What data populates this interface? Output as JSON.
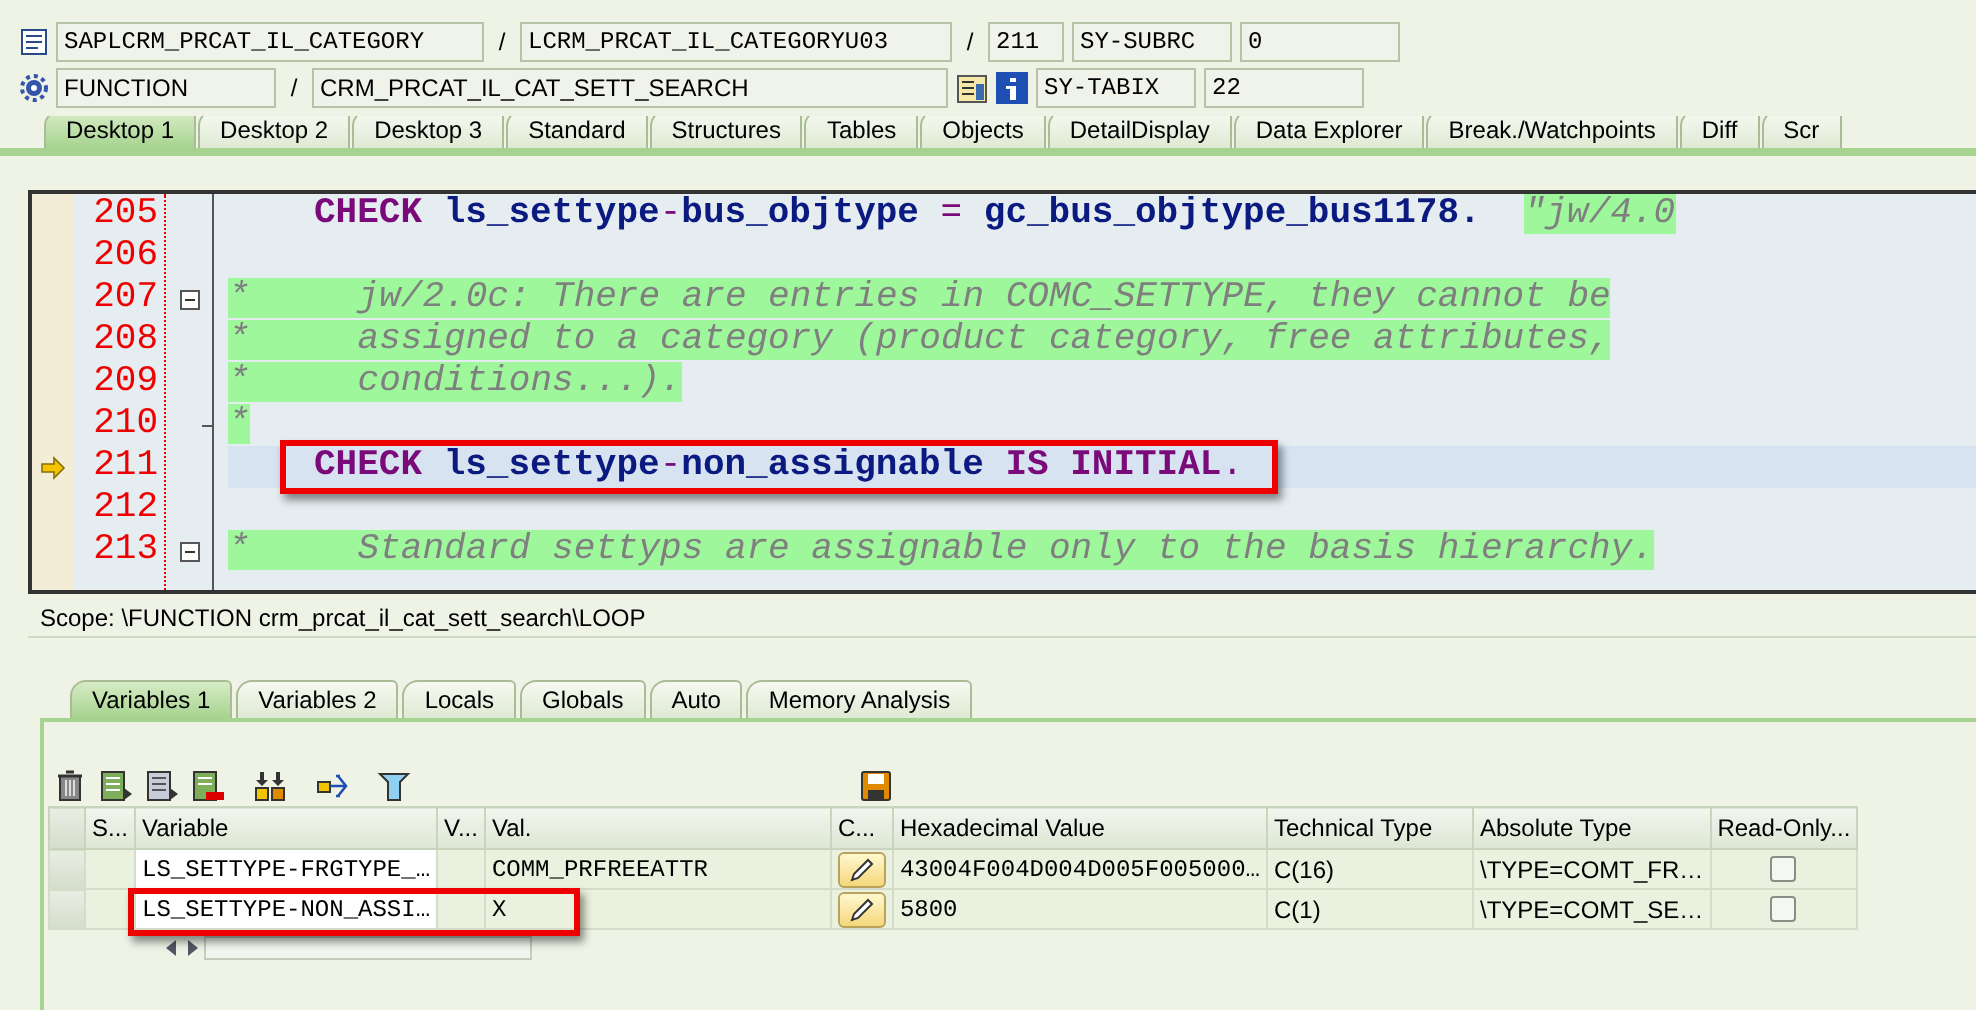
{
  "header": {
    "program": "SAPLCRM_PRCAT_IL_CATEGORY",
    "separator_1": "/",
    "include": "LCRM_PRCAT_IL_CATEGORYU03",
    "separator_2": "/",
    "line": "211",
    "field_1_name": "SY-SUBRC",
    "field_1_value": "0",
    "event_type": "FUNCTION",
    "separator_3": "/",
    "event_name": "CRM_PRCAT_IL_CAT_SETT_SEARCH",
    "field_2_name": "SY-TABIX",
    "field_2_value": "22"
  },
  "desktop_tabs": [
    {
      "label": "Desktop 1",
      "selected": true
    },
    {
      "label": "Desktop 2",
      "selected": false
    },
    {
      "label": "Desktop 3",
      "selected": false
    },
    {
      "label": "Standard",
      "selected": false
    },
    {
      "label": "Structures",
      "selected": false
    },
    {
      "label": "Tables",
      "selected": false
    },
    {
      "label": "Objects",
      "selected": false
    },
    {
      "label": "DetailDisplay",
      "selected": false
    },
    {
      "label": "Data Explorer",
      "selected": false
    },
    {
      "label": "Break./Watchpoints",
      "selected": false
    },
    {
      "label": "Diff",
      "selected": false
    },
    {
      "label": "Scr",
      "selected": false
    }
  ],
  "code_lines": [
    {
      "number": "205",
      "current": false,
      "fold_start": false,
      "fold_end": false,
      "callout": false,
      "indented": true,
      "segments": [
        {
          "kind": "keyword",
          "text": "CHECK"
        },
        {
          "kind": "identifier",
          "text": " ls_settype"
        },
        {
          "kind": "operator",
          "text": "-"
        },
        {
          "kind": "identifier",
          "text": "bus_objtype "
        },
        {
          "kind": "operator",
          "text": "="
        },
        {
          "kind": "identifier",
          "text": " gc_bus_objtype_bus1178.  "
        },
        {
          "kind": "comment",
          "text": "\"jw/4.0"
        }
      ]
    },
    {
      "number": "206",
      "current": false,
      "fold_start": false,
      "fold_end": false
    },
    {
      "number": "207",
      "current": false,
      "fold_start": true,
      "fold_end": false,
      "callout": false,
      "indented": false,
      "segments": [
        {
          "kind": "comment",
          "text": "*     jw/2.0c: There are entries in COMC_SETTYPE, they cannot be"
        }
      ]
    },
    {
      "number": "208",
      "current": false,
      "fold_start": false,
      "fold_end": false,
      "callout": false,
      "indented": false,
      "segments": [
        {
          "kind": "comment",
          "text": "*     assigned to a category (product category, free attributes,"
        }
      ]
    },
    {
      "number": "209",
      "current": false,
      "fold_start": false,
      "fold_end": false,
      "callout": false,
      "indented": false,
      "segments": [
        {
          "kind": "comment",
          "text": "*     conditions...)."
        }
      ]
    },
    {
      "number": "210",
      "current": false,
      "fold_start": false,
      "fold_end": true,
      "callout": false,
      "indented": false,
      "segments": [
        {
          "kind": "comment",
          "text": "*"
        }
      ]
    },
    {
      "number": "211",
      "current": true,
      "fold_start": false,
      "fold_end": false,
      "callout": true,
      "indented": true,
      "segments": [
        {
          "kind": "keyword",
          "text": "CHECK"
        },
        {
          "kind": "identifier",
          "text": " ls_settype"
        },
        {
          "kind": "operator",
          "text": "-"
        },
        {
          "kind": "identifier",
          "text": "non_assignable "
        },
        {
          "kind": "keyword",
          "text": "IS INITIAL"
        },
        {
          "kind": "operator",
          "text": "."
        }
      ]
    },
    {
      "number": "212",
      "current": false,
      "fold_start": false,
      "fold_end": false
    },
    {
      "number": "213",
      "current": false,
      "fold_start": true,
      "fold_end": false,
      "callout": false,
      "indented": false,
      "segments": [
        {
          "kind": "comment",
          "text": "*     Standard settyps are assignable only to the basis hierarchy."
        }
      ]
    }
  ],
  "scope": "Scope: \\FUNCTION crm_prcat_il_cat_sett_search\\LOOP",
  "variable_tabs": [
    {
      "label": "Variables 1",
      "selected": true
    },
    {
      "label": "Variables 2",
      "selected": false
    },
    {
      "label": "Locals",
      "selected": false
    },
    {
      "label": "Globals",
      "selected": false
    },
    {
      "label": "Auto",
      "selected": false
    },
    {
      "label": "Memory Analysis",
      "selected": false
    }
  ],
  "table": {
    "columns": [
      "S...",
      "Variable",
      "V...",
      "Val.",
      "C...",
      "Hexadecimal Value",
      "Technical Type",
      "Absolute Type",
      "Read-Only..."
    ],
    "rows": [
      {
        "variable": "LS_SETTYPE-FRGTYPE_…",
        "value": "COMM_PRFREEATTR",
        "hex": "43004F004D004D005F005000…",
        "technical_type": "C(16)",
        "absolute_type": "\\TYPE=COMT_FR…",
        "read_only": false,
        "callout": false
      },
      {
        "variable": "LS_SETTYPE-NON_ASSI…",
        "value": "X",
        "hex": "5800",
        "technical_type": "C(1)",
        "absolute_type": "\\TYPE=COMT_SE…",
        "read_only": false,
        "callout": true
      }
    ]
  }
}
